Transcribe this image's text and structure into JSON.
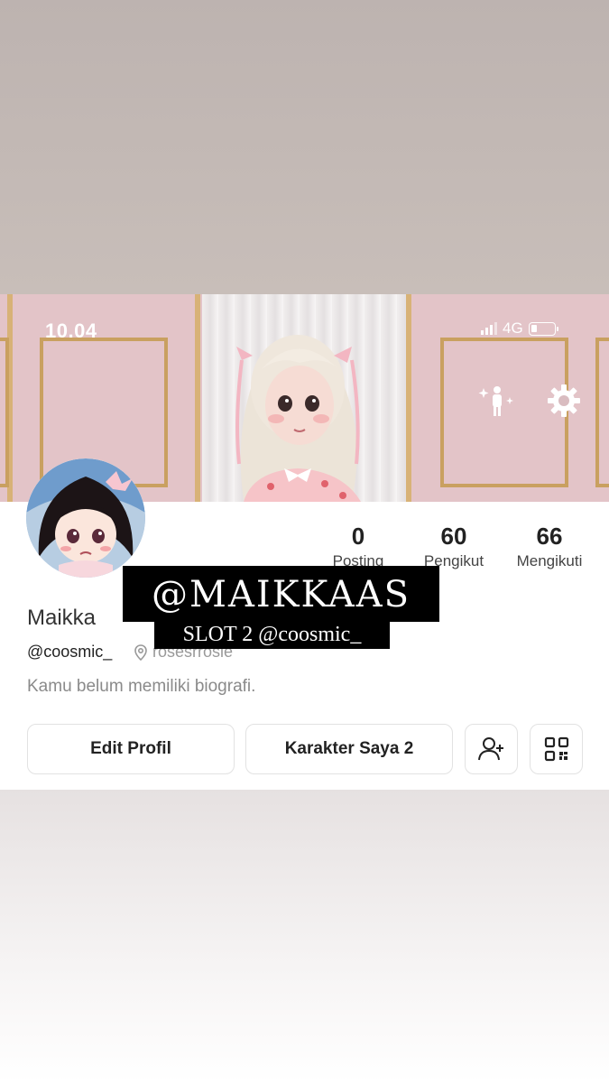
{
  "status_bar": {
    "time": "10.04",
    "network": "4G"
  },
  "header_icons": {
    "avatar_ai": "avatar-sparkle-icon",
    "settings": "gear-icon"
  },
  "profile": {
    "display_name": "Maikka",
    "username": "@coosmic_",
    "location": "rosesrrosie",
    "bio": "Kamu belum memiliki biografi."
  },
  "stats": [
    {
      "value": "0",
      "label": "Posting"
    },
    {
      "value": "60",
      "label": "Pengikut"
    },
    {
      "value": "66",
      "label": "Mengikuti"
    }
  ],
  "actions": {
    "edit_profile": "Edit Profil",
    "my_character": "Karakter Saya 2",
    "add_friend_icon": "add-user-icon",
    "qr_icon": "qr-code-icon"
  },
  "overlay": {
    "title": "@MAIKKAAS",
    "subtitle": "SLOT 2 @coosmic_"
  },
  "colors": {
    "cover_pink": "#e3c4c8",
    "frame_gold": "#c9a060",
    "caption_bg": "#000000"
  }
}
